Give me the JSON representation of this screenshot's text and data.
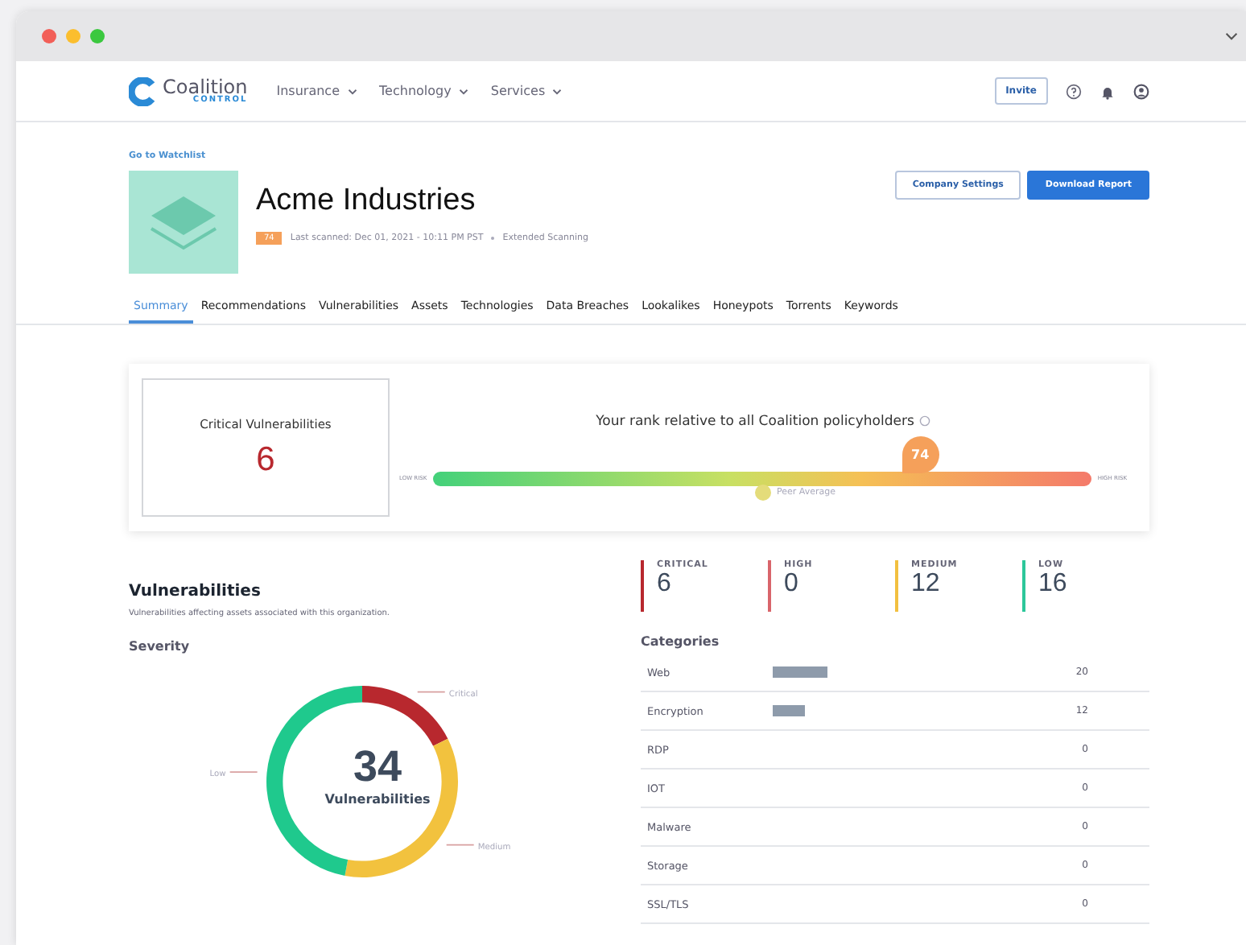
{
  "nav": {
    "brand": "Coalition",
    "brand_sub": "CONTROL",
    "menus": [
      "Insurance",
      "Technology",
      "Services"
    ],
    "invite": "Invite"
  },
  "company": {
    "back_link": "Go to Watchlist",
    "name": "Acme Industries",
    "score": "74",
    "scanned": "Last scanned: Dec 01, 2021 - 10:11 PM PST",
    "scan_mode": "Extended Scanning",
    "buttons": [
      {
        "label": "Company Settings",
        "kind": "outline"
      },
      {
        "label": "Download Report",
        "kind": "primary"
      }
    ]
  },
  "tabs": [
    {
      "label": "Summary",
      "selected": true
    },
    {
      "label": "Recommendations",
      "selected": false
    },
    {
      "label": "Vulnerabilities",
      "selected": false
    },
    {
      "label": "Assets",
      "selected": false
    },
    {
      "label": "Technologies",
      "selected": false
    },
    {
      "label": "Data Breaches",
      "selected": false
    },
    {
      "label": "Lookalikes",
      "selected": false
    },
    {
      "label": "Honeypots",
      "selected": false
    },
    {
      "label": "Torrents",
      "selected": false
    },
    {
      "label": "Keywords",
      "selected": false
    }
  ],
  "critical_card": {
    "label": "Critical Vulnerabilities",
    "value": "6"
  },
  "rank": {
    "title": "Your rank relative to all Coalition policyholders",
    "low_label": "LOW RISK",
    "high_label": "HIGH RISK",
    "score": "74",
    "level": 0.74,
    "peer": {
      "label": "Peer Average",
      "level": 0.5
    }
  },
  "vulnerabilities": {
    "title": "Vulnerabilities",
    "subtitle": "Vulnerabilities affecting assets associated with this organization.",
    "severity_title": "Severity",
    "chart_data": {
      "type": "donut",
      "categories": [
        "Critical",
        "Medium",
        "Low"
      ],
      "values": [
        17.6,
        35.3,
        47.1
      ]
    },
    "total": "34",
    "total_label": "Vulnerabilities"
  },
  "counts": [
    {
      "label": "CRITICAL",
      "value": "6",
      "color": "#b8282e"
    },
    {
      "label": "HIGH",
      "value": "0",
      "color": "#d9656b"
    },
    {
      "label": "MEDIUM",
      "value": "12",
      "color": "#f2c040"
    },
    {
      "label": "LOW",
      "value": "16",
      "color": "#2cc79a"
    }
  ],
  "categories": {
    "title": "Categories",
    "rows": [
      {
        "name": "Web",
        "count": "20"
      },
      {
        "name": "Encryption",
        "count": "12"
      },
      {
        "name": "RDP",
        "count": "0"
      },
      {
        "name": "IOT",
        "count": "0"
      },
      {
        "name": "Malware",
        "count": "0"
      },
      {
        "name": "Storage",
        "count": "0"
      },
      {
        "name": "SSL/TLS",
        "count": "0"
      }
    ]
  }
}
